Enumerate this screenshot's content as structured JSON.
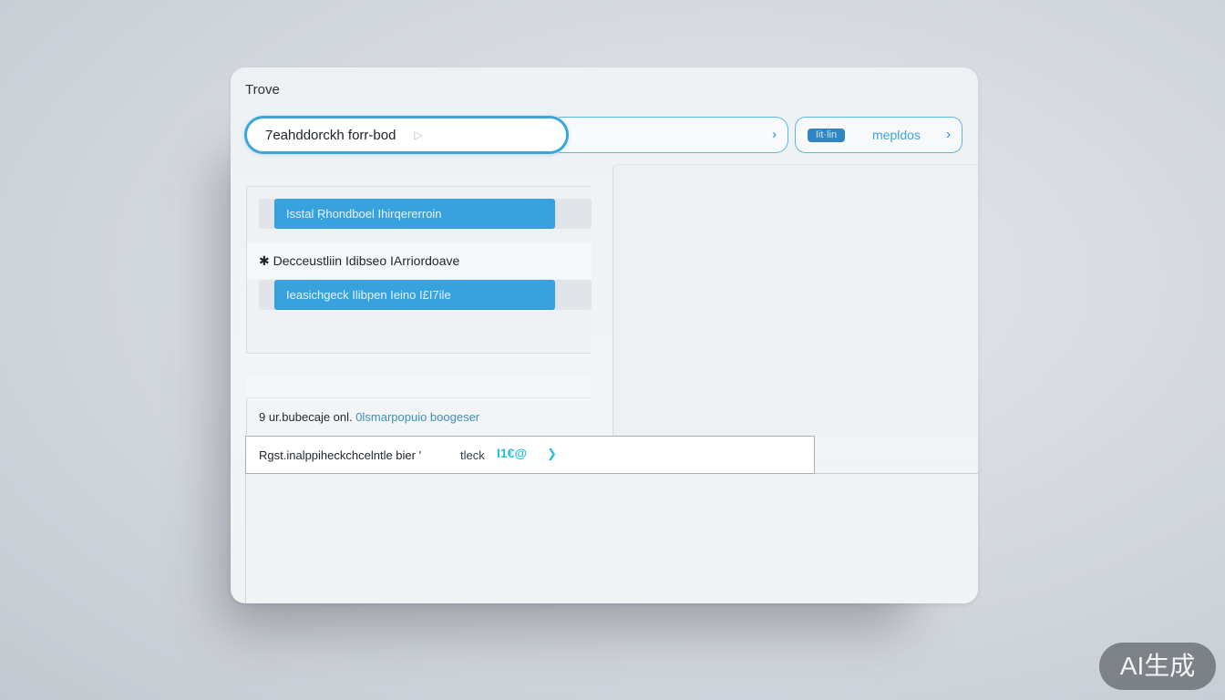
{
  "window": {
    "title": "Trove"
  },
  "search": {
    "value": "7eahddorckh forr-bod"
  },
  "segment": {
    "chip_label": "Iit·lin",
    "label": "mepldos"
  },
  "list": {
    "row1_label": "Isstal  Ṛhondboel  Ihirqererroin",
    "section_label": "✱ Decceustliin Idibseo IArriordoave",
    "row2_label": "Ieasichgeck Ilibpen Ieino I£I7ile"
  },
  "info": {
    "text_a": "9 ur.bubecaje onl.",
    "text_b": "0lsmarpopuio boogeser"
  },
  "input_bar": {
    "label": "Rgst.inalppiheckchcelntle bier '",
    "tag": "tleck",
    "icon_text": "I1€@"
  },
  "badge": {
    "text": "AI生成"
  },
  "colors": {
    "accent": "#38a2df",
    "border_accent": "#3ba7d9",
    "cyan": "#27c0d8"
  }
}
